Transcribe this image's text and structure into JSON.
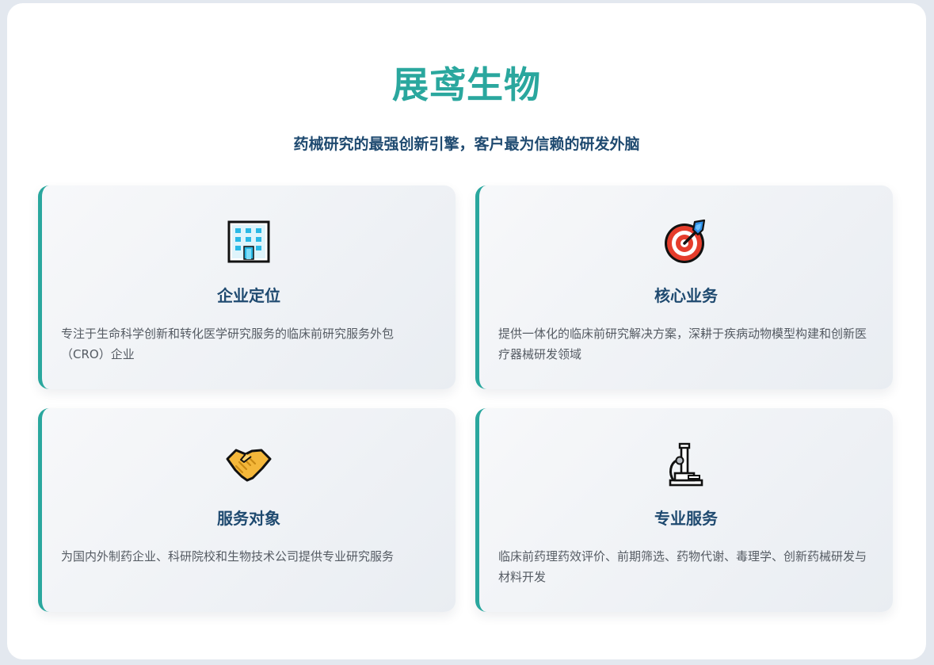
{
  "header": {
    "title": "展鸢生物",
    "subtitle": "药械研究的最强创新引擎，客户最为信赖的研发外脑"
  },
  "colors": {
    "accent": "#2aa79e",
    "heading": "#1f4a70",
    "body_text": "#555b63"
  },
  "cards": [
    {
      "icon": "office-building-icon",
      "title": "企业定位",
      "description": "专注于生命科学创新和转化医学研究服务的临床前研究服务外包（CRO）企业"
    },
    {
      "icon": "target-icon",
      "title": "核心业务",
      "description": "提供一体化的临床前研究解决方案，深耕于疾病动物模型构建和创新医疗器械研发领域"
    },
    {
      "icon": "handshake-icon",
      "title": "服务对象",
      "description": "为国内外制药企业、科研院校和生物技术公司提供专业研究服务"
    },
    {
      "icon": "microscope-icon",
      "title": "专业服务",
      "description": "临床前药理药效评价、前期筛选、药物代谢、毒理学、创新药械研发与材料开发"
    }
  ]
}
